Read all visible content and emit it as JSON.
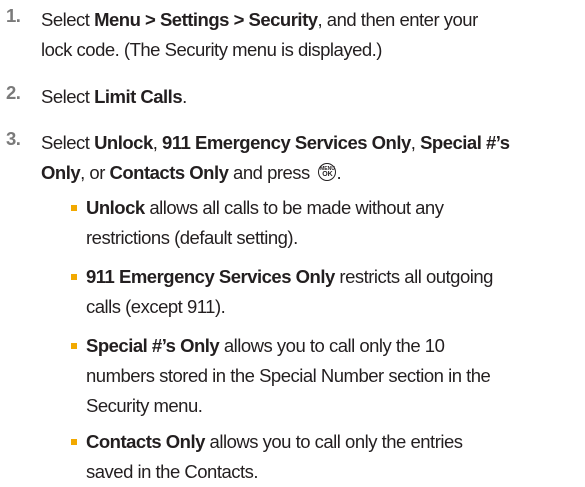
{
  "steps": [
    {
      "number": "1.",
      "lines": [
        [
          "Select ",
          {
            "b": "Menu > Settings > Security"
          },
          ", and then enter your"
        ],
        [
          "lock code. (The Security menu is displayed.)"
        ]
      ]
    },
    {
      "number": "2.",
      "lines": [
        [
          "Select ",
          {
            "b": "Limit Calls"
          },
          "."
        ]
      ]
    },
    {
      "number": "3.",
      "lines": [
        [
          "Select ",
          {
            "b": "Unlock"
          },
          ", ",
          {
            "b": "911 Emergency Services Only"
          },
          ", ",
          {
            "b": "Special #’s"
          }
        ],
        [
          {
            "b": "Only"
          },
          ", or ",
          {
            "b": "Contacts Only"
          },
          " and press ",
          {
            "icon": "menu-ok-key"
          },
          "."
        ]
      ]
    }
  ],
  "bullets": [
    {
      "lines": [
        [
          {
            "b": "Unlock"
          },
          " allows all calls to be made without any"
        ],
        [
          "restrictions (default setting)."
        ]
      ]
    },
    {
      "lines": [
        [
          {
            "b": "911 Emergency Services Only"
          },
          " restricts all outgoing"
        ],
        [
          "calls (except 911)."
        ]
      ]
    },
    {
      "lines": [
        [
          {
            "b": "Special #’s Only"
          },
          " allows you to call only the 10"
        ],
        [
          "numbers stored in the Special Number section in the"
        ],
        [
          "Security menu."
        ]
      ]
    },
    {
      "lines": [
        [
          {
            "b": "Contacts Only"
          },
          " allows you to call only the entries"
        ],
        [
          "saved in the Contacts."
        ]
      ]
    }
  ],
  "key_icon": {
    "top": "MENU",
    "bottom": "OK"
  },
  "colors": {
    "text": "#231f20",
    "step_number": "#7a7a7a",
    "bullet": "#f2a900"
  }
}
